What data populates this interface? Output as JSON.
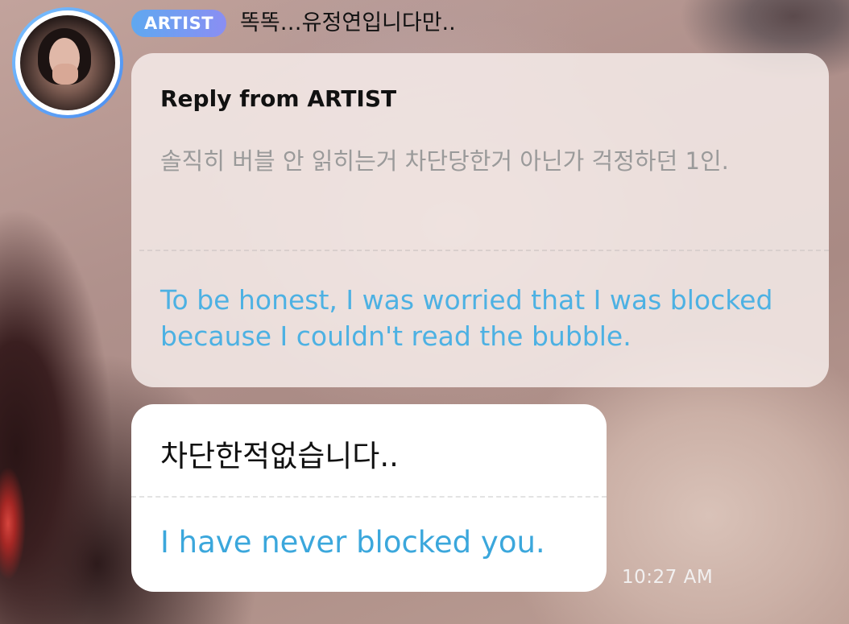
{
  "sender": {
    "badge_label": "ARTIST",
    "title": "똑똑…유정연입니다만.."
  },
  "reply": {
    "header": "Reply from ARTIST",
    "quote": "솔직히 버블 안 읽히는거 차단당한거 아닌가 걱정하던 1인.",
    "translation": "To be honest, I was worried that I was blocked because I couldn't read the bubble."
  },
  "message": {
    "text": "차단한적없습니다..",
    "translation": "I have never blocked you.",
    "timestamp": "10:27 AM"
  },
  "colors": {
    "badge_gradient_start": "#5fa8f0",
    "badge_gradient_end": "#8a8ef3",
    "translation_blue": "#3ba7dc",
    "quote_gray": "#9a9a9a"
  }
}
